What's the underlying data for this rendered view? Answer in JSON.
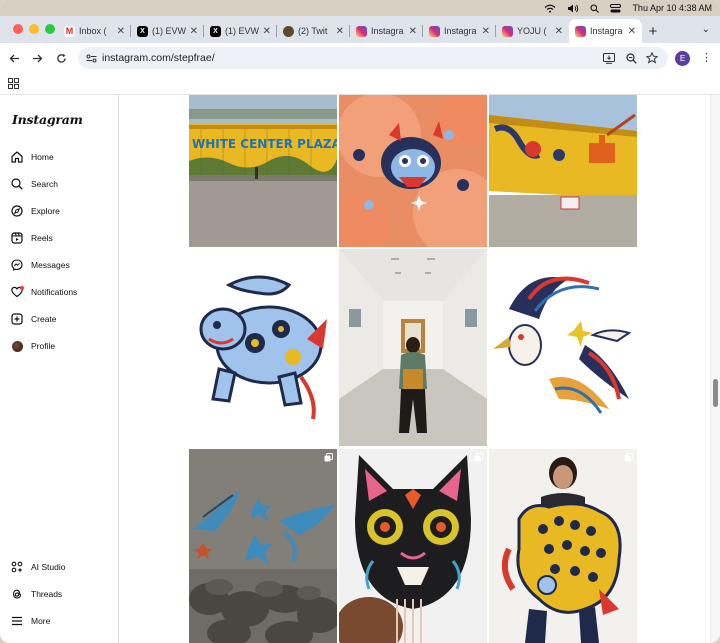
{
  "menubar": {
    "datetime": "Thu Apr 10  4:38 AM"
  },
  "tabs": [
    {
      "title": "Inbox (",
      "favicon": "gmail-icon",
      "active": false
    },
    {
      "title": "(1) EVW",
      "favicon": "x-icon",
      "active": false
    },
    {
      "title": "(1) EVW",
      "favicon": "x-icon",
      "active": false
    },
    {
      "title": "(2) Twit",
      "favicon": "twitch-icon",
      "active": false
    },
    {
      "title": "Instagra",
      "favicon": "instagram-icon",
      "active": false
    },
    {
      "title": "Instagra",
      "favicon": "instagram-icon",
      "active": false
    },
    {
      "title": "YOJU (",
      "favicon": "instagram-icon",
      "active": false
    },
    {
      "title": "Instagra",
      "favicon": "instagram-icon",
      "active": true
    }
  ],
  "toolbar": {
    "url": "instagram.com/stepfrae/",
    "profile_initial": "E"
  },
  "sidebar": {
    "logo": "Instagram",
    "items": [
      {
        "label": "Home",
        "icon": "home-icon"
      },
      {
        "label": "Search",
        "icon": "search-icon"
      },
      {
        "label": "Explore",
        "icon": "compass-icon"
      },
      {
        "label": "Reels",
        "icon": "reels-icon"
      },
      {
        "label": "Messages",
        "icon": "messenger-icon"
      },
      {
        "label": "Notifications",
        "icon": "heart-icon"
      },
      {
        "label": "Create",
        "icon": "plus-square-icon"
      },
      {
        "label": "Profile",
        "icon": "profile-avatar"
      }
    ],
    "bottom_items": [
      {
        "label": "AI Studio",
        "icon": "ai-studio-icon"
      },
      {
        "label": "Threads",
        "icon": "threads-icon"
      },
      {
        "label": "More",
        "icon": "menu-icon"
      }
    ]
  },
  "grid": {
    "posts": [
      {
        "description": "WHITE CENTER PLAZA"
      },
      {
        "description": "tiger stickers"
      },
      {
        "description": "mural on building"
      },
      {
        "description": "blue tiger cutout"
      },
      {
        "description": "artist in gallery"
      },
      {
        "description": "cranes cutout"
      },
      {
        "description": "bird mural"
      },
      {
        "description": "cat mask"
      },
      {
        "description": "woman holding leopard"
      }
    ]
  },
  "colors": {
    "accent": "#0095f6",
    "profile_badge": "#5a3f9e",
    "notification_dot": "#ff3040"
  }
}
